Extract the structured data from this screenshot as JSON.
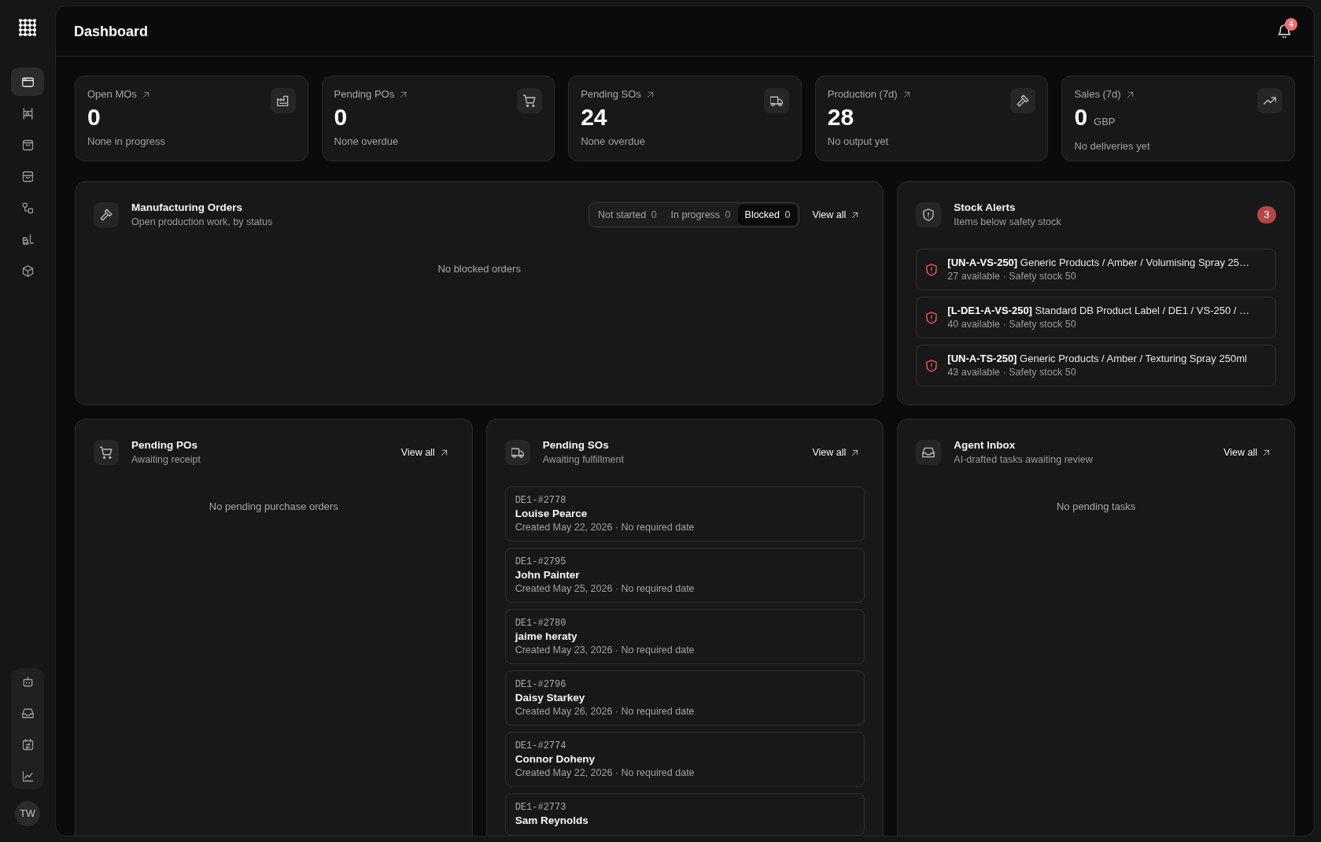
{
  "sidebar": {
    "nav": [
      {
        "kind": "window",
        "selected": true
      },
      {
        "kind": "shelf",
        "selected": false
      },
      {
        "kind": "bag",
        "selected": false
      },
      {
        "kind": "archive",
        "selected": false
      },
      {
        "kind": "nodes",
        "selected": false
      },
      {
        "kind": "forklift",
        "selected": false
      },
      {
        "kind": "cube",
        "selected": false
      }
    ],
    "tools": [
      {
        "kind": "robot",
        "selected": false
      },
      {
        "kind": "tray",
        "selected": false
      },
      {
        "kind": "calendar",
        "selected": false
      },
      {
        "kind": "chart",
        "selected": false
      }
    ],
    "avatar": "TW"
  },
  "header": {
    "title": "Dashboard",
    "notification_count": "4"
  },
  "kpis": [
    {
      "kind": "factory",
      "label": "Open MOs",
      "value": "0",
      "note": "None in progress"
    },
    {
      "kind": "cart",
      "label": "Pending POs",
      "value": "0",
      "note": "None overdue"
    },
    {
      "kind": "truck",
      "label": "Pending SOs",
      "value": "24",
      "note": "None overdue"
    },
    {
      "kind": "hammer",
      "label": "Production (7d)",
      "value": "28",
      "note": "No output yet"
    },
    {
      "kind": "trend",
      "label": "Sales (7d)",
      "value": "0",
      "unit": "GBP",
      "note": "No deliveries yet"
    }
  ],
  "manufacturing_orders": {
    "title": "Manufacturing Orders",
    "subtitle": "Open production work, by status",
    "filters": [
      {
        "label": "Not started",
        "count": "0",
        "selected": false
      },
      {
        "label": "In progress",
        "count": "0",
        "selected": false
      },
      {
        "label": "Blocked",
        "count": "0",
        "selected": true
      }
    ],
    "view_all": "View all",
    "empty": "No blocked orders"
  },
  "stock_alerts": {
    "title": "Stock Alerts",
    "subtitle": "Items below safety stock",
    "count": "3",
    "items": [
      {
        "name": "**[UN-A-VS-250]** Generic Products / Amber / Volumising Spray 25…",
        "detail": "27 available · Safety stock 50"
      },
      {
        "name": "**[L-DE1-A-VS-250]** Standard DB Product Label / DE1 / VS-250 / …",
        "detail": "40 available · Safety stock 50"
      },
      {
        "name": "**[UN-A-TS-250]** Generic Products / Amber / Texturing Spray 250ml",
        "detail": "43 available · Safety stock 50"
      }
    ]
  },
  "pending_pos": {
    "title": "Pending POs",
    "subtitle": "Awaiting receipt",
    "view_all": "View all",
    "empty": "No pending purchase orders"
  },
  "pending_sos": {
    "title": "Pending SOs",
    "subtitle": "Awaiting fulfillment",
    "view_all": "View all",
    "orders": [
      {
        "number": "DE1-#2778",
        "customer": "Louise Pearce",
        "detail": "Created May 22, 2026 · No required date"
      },
      {
        "number": "DE1-#2795",
        "customer": "John Painter",
        "detail": "Created May 25, 2026 · No required date"
      },
      {
        "number": "DE1-#2780",
        "customer": "jaime heraty",
        "detail": "Created May 23, 2026 · No required date"
      },
      {
        "number": "DE1-#2796",
        "customer": "Daisy Starkey",
        "detail": "Created May 26, 2026 · No required date"
      },
      {
        "number": "DE1-#2774",
        "customer": "Connor Doheny",
        "detail": "Created May 22, 2026 · No required date"
      },
      {
        "number": "DE1-#2773",
        "customer": "Sam Reynolds"
      }
    ]
  },
  "agent_inbox": {
    "title": "Agent Inbox",
    "subtitle": "AI-drafted tasks awaiting review",
    "view_all": "View all",
    "empty": "No pending tasks"
  }
}
